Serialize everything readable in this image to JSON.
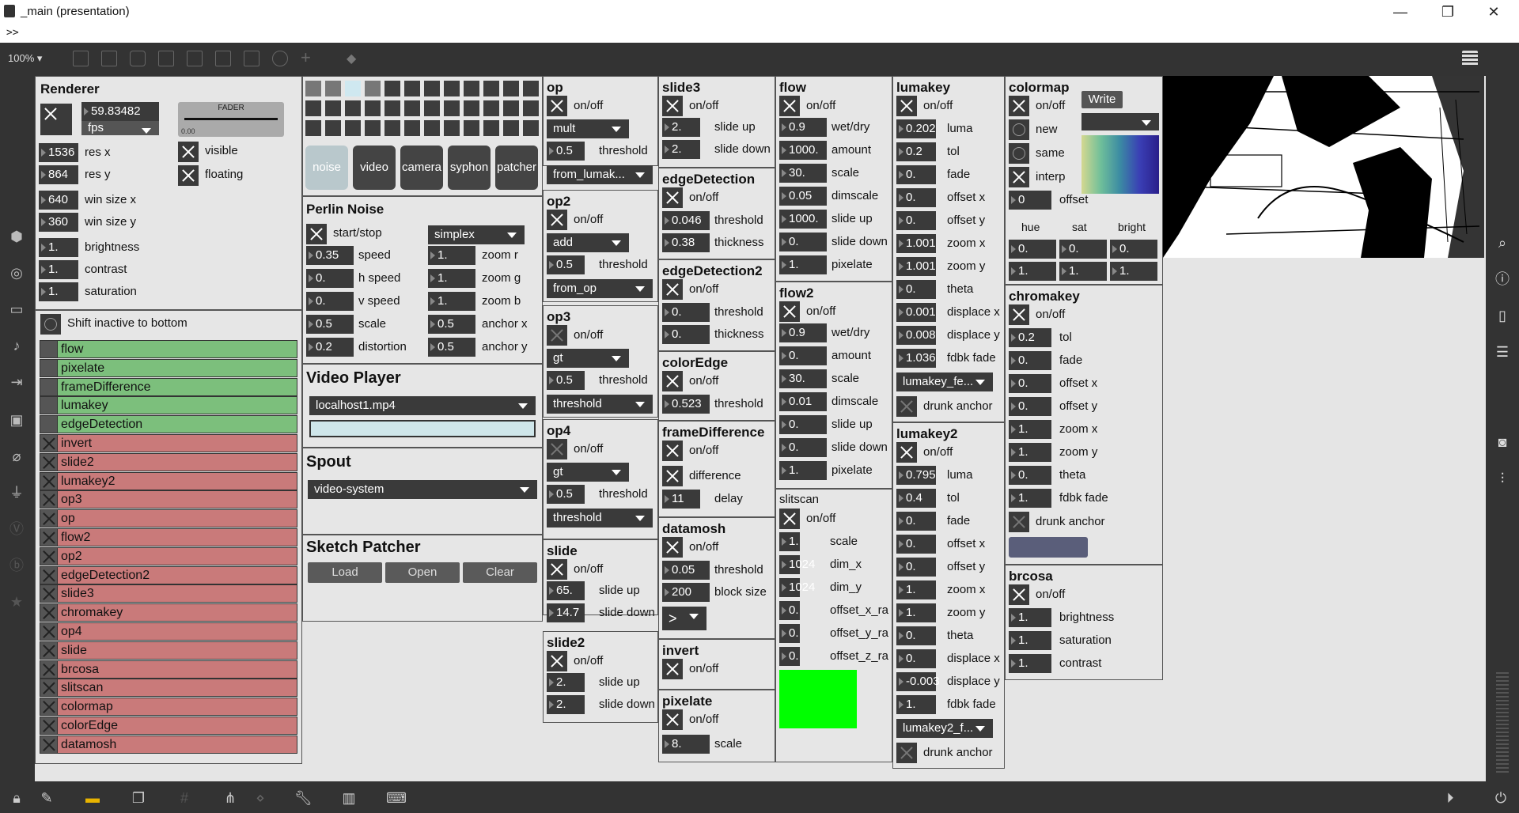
{
  "window": {
    "title": "_main (presentation)",
    "cmd": ">>"
  },
  "toolbar": {
    "zoom": "100%"
  },
  "renderer": {
    "title": "Renderer",
    "fps_value": "59.83482",
    "fps_unit": "fps",
    "fader": "FADER",
    "fader_value": "0.00",
    "res_x": "1536",
    "res_x_label": "res x",
    "res_y": "864",
    "res_y_label": "res y",
    "win_x": "640",
    "win_x_label": "win size x",
    "win_y": "360",
    "win_y_label": "win size y",
    "brightness": "1.",
    "brightness_label": "brightness",
    "contrast": "1.",
    "contrast_label": "contrast",
    "saturation": "1.",
    "saturation_label": "saturation",
    "visible": "visible",
    "floating": "floating",
    "shift": "Shift inactive to bottom"
  },
  "effects_list": {
    "active": [
      "flow",
      "pixelate",
      "frameDifference",
      "lumakey",
      "edgeDetection"
    ],
    "inactive": [
      "invert",
      "slide2",
      "lumakey2",
      "op3",
      "op",
      "flow2",
      "op2",
      "edgeDetection2",
      "slide3",
      "chromakey",
      "op4",
      "slide",
      "brcosa",
      "slitscan",
      "colormap",
      "colorEdge",
      "datamosh"
    ]
  },
  "sources": {
    "buttons": [
      "noise",
      "video",
      "camera",
      "syphon",
      "patcher"
    ]
  },
  "perlin": {
    "title": "Perlin Noise",
    "start": "start/stop",
    "mode": "simplex",
    "left": [
      {
        "v": "0.35",
        "l": "speed"
      },
      {
        "v": "0.",
        "l": "h speed"
      },
      {
        "v": "0.",
        "l": "v speed"
      },
      {
        "v": "0.5",
        "l": "scale"
      },
      {
        "v": "0.2",
        "l": "distortion"
      }
    ],
    "right": [
      {
        "v": "1.",
        "l": "zoom r"
      },
      {
        "v": "1.",
        "l": "zoom g"
      },
      {
        "v": "1.",
        "l": "zoom b"
      },
      {
        "v": "0.5",
        "l": "anchor x"
      },
      {
        "v": "0.5",
        "l": "anchor y"
      }
    ]
  },
  "video_player": {
    "title": "Video Player",
    "file": "localhost1.mp4"
  },
  "spout": {
    "title": "Spout",
    "source": "video-system"
  },
  "sketch": {
    "title": "Sketch Patcher",
    "load": "Load",
    "open": "Open",
    "clear": "Clear"
  },
  "op": {
    "title": "op",
    "onoff": "on/off",
    "mode": "mult",
    "thr": "0.5",
    "thr_l": "threshold",
    "src": "from_lumak..."
  },
  "op2": {
    "title": "op2",
    "onoff": "on/off",
    "mode": "add",
    "thr": "0.5",
    "thr_l": "threshold",
    "src": "from_op"
  },
  "op3": {
    "title": "op3",
    "onoff": "on/off",
    "mode": "gt",
    "thr": "0.5",
    "thr_l": "threshold",
    "src": "threshold"
  },
  "op4": {
    "title": "op4",
    "onoff": "on/off",
    "mode": "gt",
    "thr": "0.5",
    "thr_l": "threshold",
    "src": "threshold"
  },
  "slide": {
    "title": "slide",
    "onoff": "on/off",
    "up": "65.",
    "up_l": "slide up",
    "down": "14.7",
    "down_l": "slide down"
  },
  "slide2": {
    "title": "slide2",
    "onoff": "on/off",
    "up": "2.",
    "up_l": "slide up",
    "down": "2.",
    "down_l": "slide down"
  },
  "slide3": {
    "title": "slide3",
    "onoff": "on/off",
    "up": "2.",
    "up_l": "slide up",
    "down": "2.",
    "down_l": "slide down"
  },
  "edge": {
    "title": "edgeDetection",
    "onoff": "on/off",
    "thr": "0.046",
    "thr_l": "threshold",
    "thk": "0.38",
    "thk_l": "thickness"
  },
  "edge2": {
    "title": "edgeDetection2",
    "onoff": "on/off",
    "thr": "0.",
    "thr_l": "threshold",
    "thk": "0.",
    "thk_l": "thickness"
  },
  "coloredge": {
    "title": "colorEdge",
    "onoff": "on/off",
    "thr": "0.523",
    "thr_l": "threshold"
  },
  "framediff": {
    "title": "frameDifference",
    "onoff": "on/off",
    "diff": "difference",
    "delay": "11",
    "delay_l": "delay"
  },
  "datamosh": {
    "title": "datamosh",
    "onoff": "on/off",
    "thr": "0.05",
    "thr_l": "threshold",
    "bs": "200",
    "bs_l": "block size",
    "op": ">"
  },
  "invert": {
    "title": "invert",
    "onoff": "on/off"
  },
  "pixelate": {
    "title": "pixelate",
    "onoff": "on/off",
    "scale": "8.",
    "scale_l": "scale"
  },
  "flow": {
    "title": "flow",
    "onoff": "on/off",
    "rows": [
      {
        "v": "0.9",
        "l": "wet/dry"
      },
      {
        "v": "1000.",
        "l": "amount"
      },
      {
        "v": "30.",
        "l": "scale"
      },
      {
        "v": "0.05",
        "l": "dimscale"
      },
      {
        "v": "1000.",
        "l": "slide up"
      },
      {
        "v": "0.",
        "l": "slide down"
      },
      {
        "v": "1.",
        "l": "pixelate"
      }
    ]
  },
  "flow2": {
    "title": "flow2",
    "onoff": "on/off",
    "rows": [
      {
        "v": "0.9",
        "l": "wet/dry"
      },
      {
        "v": "0.",
        "l": "amount"
      },
      {
        "v": "30.",
        "l": "scale"
      },
      {
        "v": "0.01",
        "l": "dimscale"
      },
      {
        "v": "0.",
        "l": "slide up"
      },
      {
        "v": "0.",
        "l": "slide down"
      },
      {
        "v": "1.",
        "l": "pixelate"
      }
    ]
  },
  "slitscan": {
    "title": "slitscan",
    "onoff": "on/off",
    "rows": [
      {
        "v": "1.",
        "l": "scale"
      },
      {
        "v": "1024",
        "l": "dim_x"
      },
      {
        "v": "1024",
        "l": "dim_y"
      },
      {
        "v": "0.",
        "l": "offset_x_ra"
      },
      {
        "v": "0.",
        "l": "offset_y_ra"
      },
      {
        "v": "0.",
        "l": "offset_z_ra"
      }
    ],
    "swatch": "#00ff00"
  },
  "lumakey": {
    "title": "lumakey",
    "onoff": "on/off",
    "rows": [
      {
        "v": "0.202",
        "l": "luma"
      },
      {
        "v": "0.2",
        "l": "tol"
      },
      {
        "v": "0.",
        "l": "fade"
      },
      {
        "v": "0.",
        "l": "offset x"
      },
      {
        "v": "0.",
        "l": "offset y"
      },
      {
        "v": "1.001",
        "l": "zoom x"
      },
      {
        "v": "1.001",
        "l": "zoom y"
      },
      {
        "v": "0.",
        "l": "theta"
      },
      {
        "v": "0.001",
        "l": "displace x"
      },
      {
        "v": "0.008",
        "l": "displace y"
      },
      {
        "v": "1.036",
        "l": "fdbk fade"
      }
    ],
    "src": "lumakey_fe...",
    "drunk": "drunk anchor"
  },
  "lumakey2": {
    "title": "lumakey2",
    "onoff": "on/off",
    "rows": [
      {
        "v": "0.795",
        "l": "luma"
      },
      {
        "v": "0.4",
        "l": "tol"
      },
      {
        "v": "0.",
        "l": "fade"
      },
      {
        "v": "0.",
        "l": "offset x"
      },
      {
        "v": "0.",
        "l": "offset y"
      },
      {
        "v": "1.",
        "l": "zoom x"
      },
      {
        "v": "1.",
        "l": "zoom y"
      },
      {
        "v": "0.",
        "l": "theta"
      },
      {
        "v": "0.",
        "l": "displace x"
      },
      {
        "v": "-0.003",
        "l": "displace y"
      },
      {
        "v": "1.",
        "l": "fdbk fade"
      }
    ],
    "src": "lumakey2_f...",
    "drunk": "drunk anchor"
  },
  "colormap": {
    "title": "colormap",
    "onoff": "on/off",
    "write": "Write",
    "new": "new",
    "same": "same",
    "interp": "interp",
    "offset": "0",
    "offset_l": "offset",
    "hue": "hue",
    "sat": "sat",
    "bright": "bright",
    "r1": [
      "0.",
      "0.",
      "0."
    ],
    "r2": [
      "1.",
      "1.",
      "1."
    ]
  },
  "chromakey": {
    "title": "chromakey",
    "onoff": "on/off",
    "rows": [
      {
        "v": "0.2",
        "l": "tol"
      },
      {
        "v": "0.",
        "l": "fade"
      },
      {
        "v": "0.",
        "l": "offset x"
      },
      {
        "v": "0.",
        "l": "offset y"
      },
      {
        "v": "1.",
        "l": "zoom x"
      },
      {
        "v": "1.",
        "l": "zoom y"
      },
      {
        "v": "0.",
        "l": "theta"
      },
      {
        "v": "1.",
        "l": "fdbk fade"
      }
    ],
    "drunk": "drunk anchor",
    "swatch": "#5a5e7a"
  },
  "brcosa": {
    "title": "brcosa",
    "onoff": "on/off",
    "rows": [
      {
        "v": "1.",
        "l": "brightness"
      },
      {
        "v": "1.",
        "l": "saturation"
      },
      {
        "v": "1.",
        "l": "contrast"
      }
    ]
  }
}
